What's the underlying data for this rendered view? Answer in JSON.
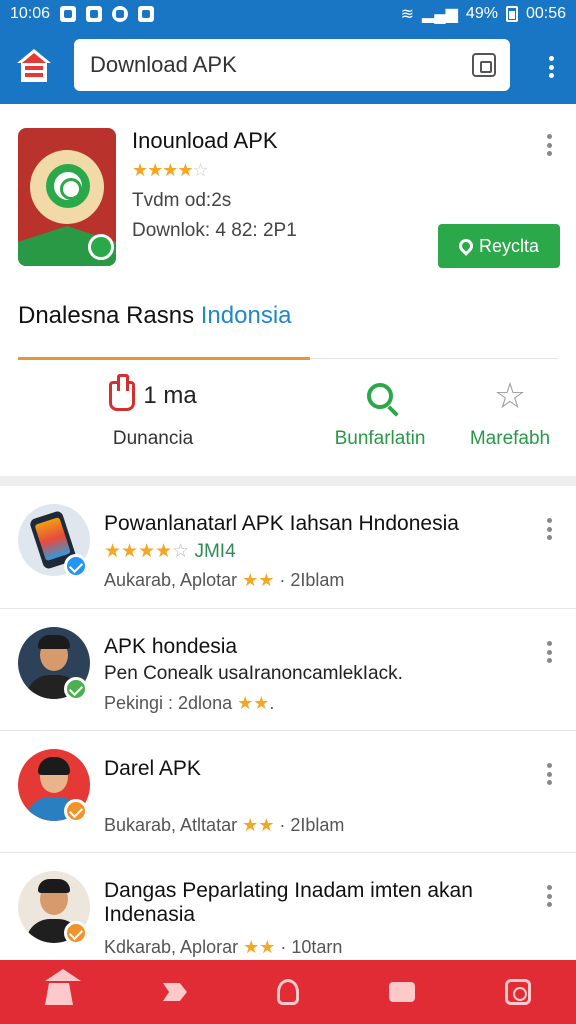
{
  "status_bar": {
    "time": "10:06",
    "battery": "49%",
    "clock_right": "00:56"
  },
  "toolbar": {
    "search_value": "Download APK"
  },
  "app": {
    "title": "Inounload APK",
    "rating_stars": 4,
    "meta1": "Tvdm od:2s",
    "meta2": "Downlok: 4 82: 2P1",
    "install_label": "Reyclta"
  },
  "section": {
    "heading_main": "Dnalesna Rasns ",
    "heading_accent": "Indonsia"
  },
  "stats": [
    {
      "value": "1 ma",
      "label": "Dunancia"
    },
    {
      "label": "Bunfarlatin"
    },
    {
      "label": "Marefabh"
    }
  ],
  "list": [
    {
      "title": "Powanlanatarl APK  Iahsan Hndonesia",
      "stars": 4,
      "sub_green": "JMI4",
      "meta_prefix": "Aukarab, Aplotar",
      "meta_suffix": "· 2Iblam",
      "badge_color": "#2196f3"
    },
    {
      "title": "APK  hondesia",
      "sub": "Pen Conealk usaIranoncamlekIack.",
      "meta_prefix": "Pekingi : 2dlona",
      "meta_suffix": ".",
      "badge_color": "#4caf50"
    },
    {
      "title": "Darel APK",
      "meta_prefix": "Bukarab, Atltatar",
      "meta_suffix": "· 2Iblam",
      "badge_color": "#f0932b"
    },
    {
      "title": "Dangas Peparlating Inadam imten akan Indenasia",
      "meta_prefix": "Kdkarab, Aplorar",
      "meta_suffix": "· 10tarn",
      "badge_color": "#f0932b"
    }
  ]
}
